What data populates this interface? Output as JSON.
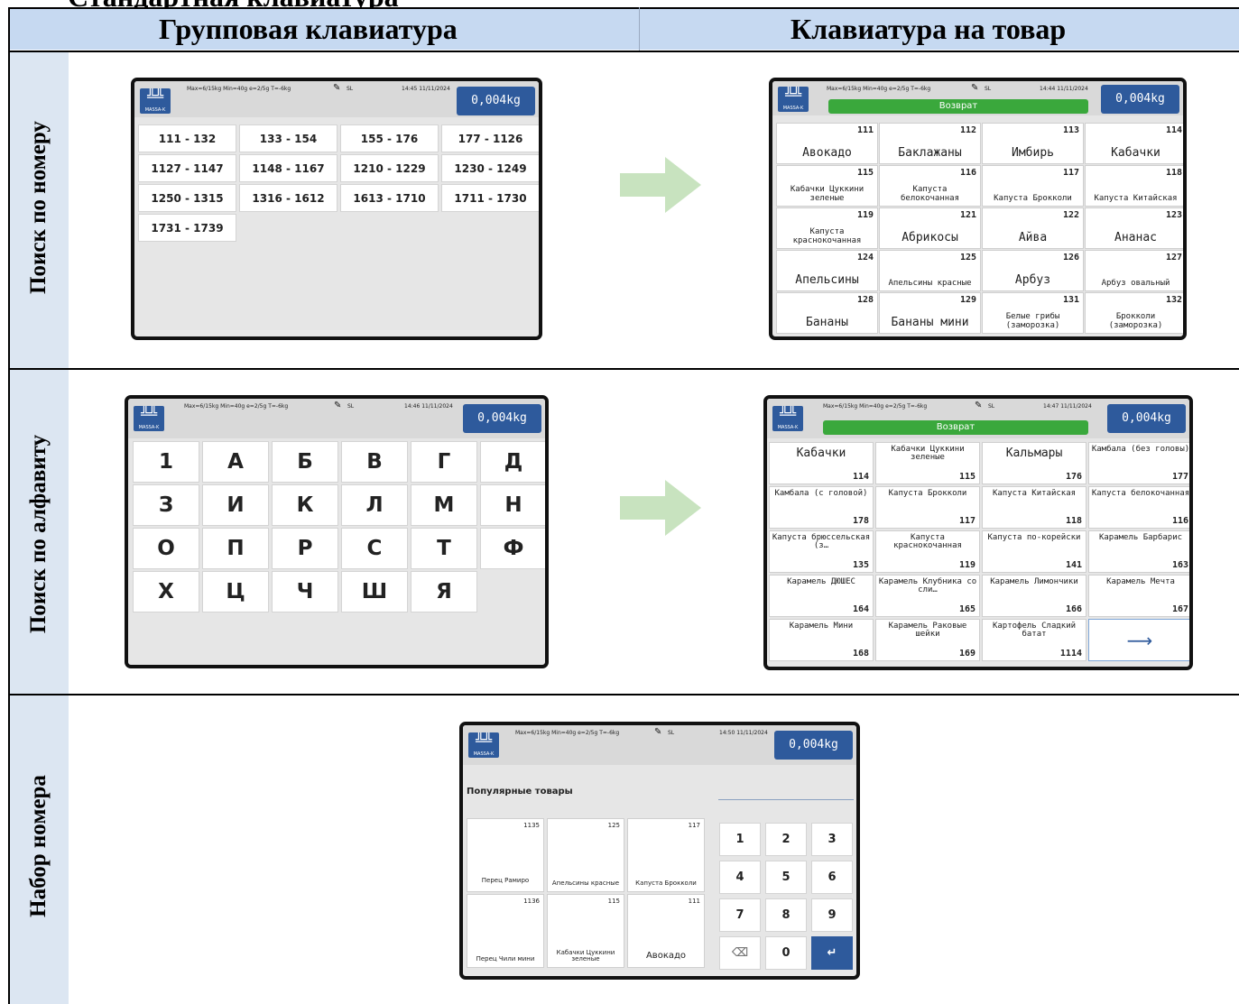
{
  "doc_title": "Стандартная клавиатура",
  "header": {
    "left": "Групповая клавиатура",
    "right": "Клавиатура на товар"
  },
  "rows": [
    "Поиск по номеру",
    "Поиск по алфавиту",
    "Набор номера"
  ],
  "device": {
    "logo_text": "MASSA-K",
    "spec": "Max=6/15kg Min=40g e=2/5g T=-6kg",
    "spec_alt": "Max=6/15kg Min=40g e=2/5g T=-6kg",
    "sl": "SL",
    "weight": "0,004kg",
    "return_label": "Возврат"
  },
  "screen1": {
    "time": "14:45 11/11/2024",
    "ranges": [
      "111 - 132",
      "133 - 154",
      "155 - 176",
      "177 - 1126",
      "1127 - 1147",
      "1148 - 1167",
      "1210 - 1229",
      "1230 - 1249",
      "1250 - 1315",
      "1316 - 1612",
      "1613 - 1710",
      "1711 - 1730",
      "1731 - 1739"
    ]
  },
  "screen2": {
    "time": "14:44 11/11/2024",
    "items": [
      {
        "num": "111",
        "name": "Авокадо"
      },
      {
        "num": "112",
        "name": "Баклажаны"
      },
      {
        "num": "113",
        "name": "Имбирь"
      },
      {
        "num": "114",
        "name": "Кабачки"
      },
      {
        "num": "115",
        "name": "Кабачки Цуккини зеленые"
      },
      {
        "num": "116",
        "name": "Капуста белокочанная"
      },
      {
        "num": "117",
        "name": "Капуста Брокколи"
      },
      {
        "num": "118",
        "name": "Капуста Китайская"
      },
      {
        "num": "119",
        "name": "Капуста краснокочанная"
      },
      {
        "num": "121",
        "name": "Абрикосы"
      },
      {
        "num": "122",
        "name": "Айва"
      },
      {
        "num": "123",
        "name": "Ананас"
      },
      {
        "num": "124",
        "name": "Апельсины"
      },
      {
        "num": "125",
        "name": "Апельсины красные"
      },
      {
        "num": "126",
        "name": "Арбуз"
      },
      {
        "num": "127",
        "name": "Арбуз овальный"
      },
      {
        "num": "128",
        "name": "Бананы"
      },
      {
        "num": "129",
        "name": "Бананы мини"
      },
      {
        "num": "131",
        "name": "Белые грибы (заморозка)"
      },
      {
        "num": "132",
        "name": "Брокколи (заморозка)"
      }
    ]
  },
  "screen3": {
    "time": "14:46 11/11/2024",
    "letters": [
      "1",
      "А",
      "Б",
      "В",
      "Г",
      "Д",
      "З",
      "И",
      "К",
      "Л",
      "М",
      "Н",
      "О",
      "П",
      "Р",
      "С",
      "Т",
      "Ф",
      "Х",
      "Ц",
      "Ч",
      "Ш",
      "Я"
    ]
  },
  "screen4": {
    "time": "14:47 11/11/2024",
    "items": [
      {
        "num": "114",
        "name": "Кабачки"
      },
      {
        "num": "115",
        "name": "Кабачки Цуккини зеленые"
      },
      {
        "num": "176",
        "name": "Кальмары"
      },
      {
        "num": "177",
        "name": "Камбала (без головы)"
      },
      {
        "num": "178",
        "name": "Камбала (с головой)"
      },
      {
        "num": "117",
        "name": "Капуста Брокколи"
      },
      {
        "num": "118",
        "name": "Капуста Китайская"
      },
      {
        "num": "116",
        "name": "Капуста белокочанная"
      },
      {
        "num": "135",
        "name": "Капуста брюссельская (з…"
      },
      {
        "num": "119",
        "name": "Капуста краснокочанная"
      },
      {
        "num": "141",
        "name": "Капуста по-корейски"
      },
      {
        "num": "163",
        "name": "Карамель Барбарис"
      },
      {
        "num": "164",
        "name": "Карамель ДЮШЕС"
      },
      {
        "num": "165",
        "name": "Карамель Клубника со сли…"
      },
      {
        "num": "166",
        "name": "Карамель Лимончики"
      },
      {
        "num": "167",
        "name": "Карамель Мечта"
      },
      {
        "num": "168",
        "name": "Карамель Мини"
      },
      {
        "num": "169",
        "name": "Карамель Раковые шейки"
      },
      {
        "num": "1114",
        "name": "Картофель Сладкий батат"
      }
    ],
    "next_arrow": "⟶"
  },
  "screen5": {
    "time": "14:50 11/11/2024",
    "popular_title": "Популярные товары",
    "items": [
      {
        "num": "1135",
        "name": "Перец Рамиро"
      },
      {
        "num": "125",
        "name": "Апельсины красные"
      },
      {
        "num": "117",
        "name": "Капуста Брокколи"
      },
      {
        "num": "1136",
        "name": "Перец Чили мини"
      },
      {
        "num": "115",
        "name": "Кабачки Цуккини зеленые"
      },
      {
        "num": "111",
        "name": "Авокадо"
      }
    ],
    "keys": [
      "1",
      "2",
      "3",
      "4",
      "5",
      "6",
      "7",
      "8",
      "9",
      "⌫",
      "0",
      "↵"
    ]
  },
  "colors": {
    "accent": "#2e5a9c",
    "green": "#3aa83c",
    "header_bg": "#c6d9f1",
    "side_bg": "#dce6f2",
    "arrow": "#c8e3bf"
  }
}
